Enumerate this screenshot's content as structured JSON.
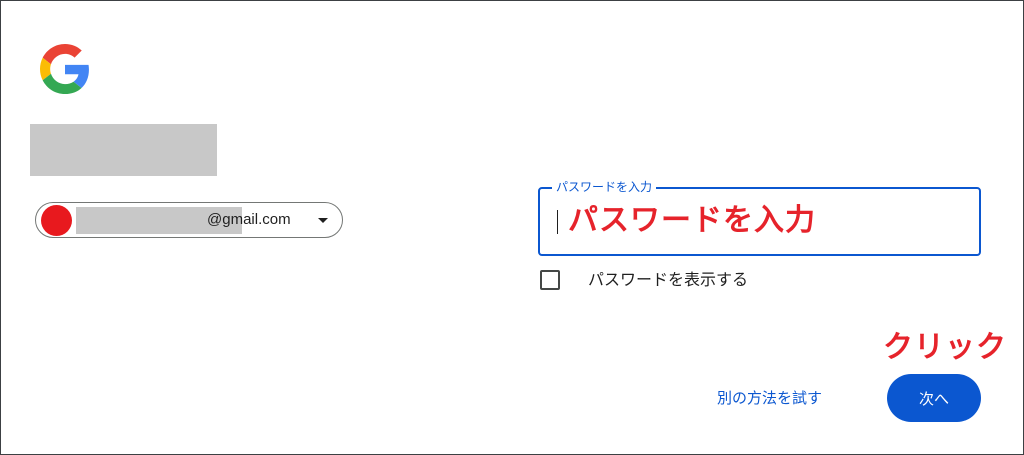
{
  "account": {
    "email_domain": "@gmail.com"
  },
  "password_field": {
    "label": "パスワードを入力",
    "annotation": "パスワードを入力"
  },
  "show_password": {
    "label": "パスワードを表示する"
  },
  "actions": {
    "try_another_way": "別の方法を試す",
    "next": "次へ",
    "click_annotation": "クリック"
  },
  "colors": {
    "accent": "#0b57d0",
    "annotation": "#e6232b",
    "avatar": "#e8191e"
  },
  "icons": {
    "logo": "google-g-logo",
    "dropdown": "chevron-down-icon"
  }
}
